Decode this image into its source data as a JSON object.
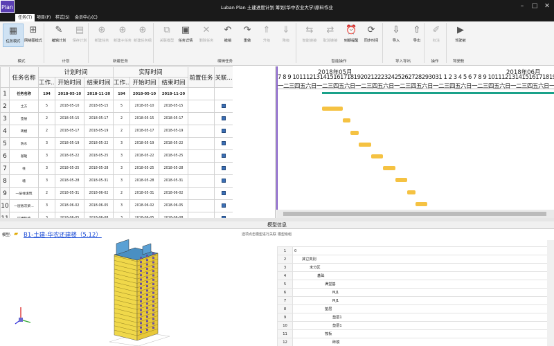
{
  "app": {
    "logo": "Plan",
    "title": "Luban Plan 土建进度计划 筹划(华中农业大学)原料作业"
  },
  "menu": [
    "任务(T)",
    "项目(P)",
    "样式(S)",
    "会员中心(C)"
  ],
  "ribbon": {
    "buttons": [
      {
        "label": "任务模式",
        "icon": "task-mode-icon",
        "glyph": "▦"
      },
      {
        "label": "网络图模式",
        "icon": "network-mode-icon",
        "glyph": "⊞"
      },
      {
        "label": "编辑计划",
        "icon": "edit-plan-icon",
        "glyph": "✎"
      },
      {
        "label": "保存计划",
        "icon": "save-plan-icon",
        "glyph": "▤"
      },
      {
        "label": "新建任务",
        "icon": "new-task-icon",
        "glyph": "⊕"
      },
      {
        "label": "新建子任务",
        "icon": "new-subtask-icon",
        "glyph": "⊕"
      },
      {
        "label": "新建任务组",
        "icon": "new-task-group-icon",
        "glyph": "⊕"
      },
      {
        "label": "关联模型",
        "icon": "link-model-icon",
        "glyph": "⧉"
      },
      {
        "label": "任务详情",
        "icon": "task-detail-icon",
        "glyph": "▣"
      },
      {
        "label": "删除任务",
        "icon": "delete-task-icon",
        "glyph": "✕"
      },
      {
        "label": "撤销",
        "icon": "undo-icon",
        "glyph": "↶"
      },
      {
        "label": "重做",
        "icon": "redo-icon",
        "glyph": "↷"
      },
      {
        "label": "升级",
        "icon": "upgrade-icon",
        "glyph": "⇑"
      },
      {
        "label": "降级",
        "icon": "downgrade-icon",
        "glyph": "⇓"
      },
      {
        "label": "智能链接",
        "icon": "smart-link-icon",
        "glyph": "⇆"
      },
      {
        "label": "取消链接",
        "icon": "unlink-icon",
        "glyph": "⇄"
      },
      {
        "label": "到期提醒",
        "icon": "due-reminder-icon",
        "glyph": "⏰"
      },
      {
        "label": "同步时间",
        "icon": "sync-time-icon",
        "glyph": "⟳"
      },
      {
        "label": "导入",
        "icon": "import-icon",
        "glyph": "⇩"
      },
      {
        "label": "导出",
        "icon": "export-icon",
        "glyph": "⇧"
      },
      {
        "label": "标注",
        "icon": "annotate-icon",
        "glyph": "✐"
      },
      {
        "label": "驾驶舱",
        "icon": "cockpit-icon",
        "glyph": "▶"
      }
    ],
    "groups": [
      "模式",
      "计划",
      "新建任务",
      "编辑任务",
      "智能操作",
      "导入导出",
      "操作",
      "驾驶舱"
    ]
  },
  "table": {
    "header": {
      "name": "任务名称",
      "plan": "计划时间",
      "actual": "实际时间",
      "work": "工作...",
      "start": "开始时间",
      "end": "结束时间",
      "pred": "前置任务",
      "rel": "关联..."
    },
    "rows": [
      {
        "n": "1",
        "name": "任务名称",
        "pw": "194",
        "ps": "2018-05-10",
        "pe": "2018-11-20",
        "aw": "194",
        "as": "2018-05-10",
        "ae": "2018-11-20"
      },
      {
        "n": "2",
        "name": "土方",
        "pw": "5",
        "ps": "2018-05-10",
        "pe": "2018-05-15",
        "aw": "5",
        "as": "2018-05-10",
        "ae": "2018-05-15"
      },
      {
        "n": "3",
        "name": "垫层",
        "pw": "2",
        "ps": "2018-05-15",
        "pe": "2018-05-17",
        "aw": "2",
        "as": "2018-05-15",
        "ae": "2018-05-17"
      },
      {
        "n": "4",
        "name": "砖模",
        "pw": "2",
        "ps": "2018-05-17",
        "pe": "2018-05-19",
        "aw": "2",
        "as": "2018-05-17",
        "ae": "2018-05-19"
      },
      {
        "n": "5",
        "name": "防水",
        "pw": "3",
        "ps": "2018-05-19",
        "pe": "2018-05-22",
        "aw": "3",
        "as": "2018-05-19",
        "ae": "2018-05-22"
      },
      {
        "n": "6",
        "name": "基础",
        "pw": "3",
        "ps": "2018-05-22",
        "pe": "2018-05-25",
        "aw": "3",
        "as": "2018-05-22",
        "ae": "2018-05-25"
      },
      {
        "n": "7",
        "name": "柱",
        "pw": "3",
        "ps": "2018-05-25",
        "pe": "2018-05-28",
        "aw": "3",
        "as": "2018-05-25",
        "ae": "2018-05-28"
      },
      {
        "n": "8",
        "name": "墙",
        "pw": "3",
        "ps": "2018-05-28",
        "pe": "2018-05-31",
        "aw": "3",
        "as": "2018-05-28",
        "ae": "2018-05-31"
      },
      {
        "n": "9",
        "name": "一层柱填筑",
        "pw": "2",
        "ps": "2018-05-31",
        "pe": "2018-06-02",
        "aw": "2",
        "as": "2018-05-31",
        "ae": "2018-06-02"
      },
      {
        "n": "10",
        "name": "一层板次梁...",
        "pw": "3",
        "ps": "2018-06-02",
        "pe": "2018-06-05",
        "aw": "3",
        "as": "2018-06-02",
        "ae": "2018-06-05"
      },
      {
        "n": "11",
        "name": "一层楼板填...",
        "pw": "3",
        "ps": "2018-06-05",
        "pe": "2018-06-08",
        "aw": "3",
        "as": "2018-06-05",
        "ae": "2018-06-08"
      },
      {
        "n": "12",
        "name": "二层柱填筑",
        "pw": "3",
        "ps": "2018-06-08",
        "pe": "2018-06-11",
        "aw": "3",
        "as": "2018-06-08",
        "ae": "2018-06-11"
      }
    ]
  },
  "gantt": {
    "month1": "2018年05月",
    "month2": "2018年06月",
    "days": "7 8 9 10111213141516171819202122232425262728293031 1 2 3 4 5 6 7 8 9 10111213141516171819202122",
    "weeks": "一二三四五六日一二三四五六日一二三四五六日一二三四五六日一二三四五六日一二三四五六日一二三四五六日一二三",
    "bars": [
      {
        "d0": 11,
        "d1": 16,
        "sum": true
      },
      {
        "d0": 11,
        "d1": 16
      },
      {
        "d0": 16,
        "d1": 18
      },
      {
        "d0": 18,
        "d1": 20
      },
      {
        "d0": 20,
        "d1": 23
      },
      {
        "d0": 23,
        "d1": 26
      },
      {
        "d0": 26,
        "d1": 29
      },
      {
        "d0": 29,
        "d1": 32
      },
      {
        "d0": 32,
        "d1": 34
      },
      {
        "d0": 34,
        "d1": 37
      },
      {
        "d0": 37,
        "d1": 40
      },
      {
        "d0": 40,
        "d1": 43
      }
    ]
  },
  "model": {
    "header": "模型信息",
    "label": "模型:",
    "link": "B1-土建-华农还建楼（5.12）",
    "hint": "选项点击模型进行关联",
    "tree_title": "模型级组",
    "tree": [
      {
        "n": "1",
        "t": "0",
        "lv": 0
      },
      {
        "n": "2",
        "t": "其它类别",
        "lv": 1
      },
      {
        "n": "3",
        "t": "未分区",
        "lv": 2
      },
      {
        "n": "4",
        "t": "基础",
        "lv": 3
      },
      {
        "n": "5",
        "t": "满堂基",
        "lv": 4
      },
      {
        "n": "6",
        "t": "MJ1",
        "lv": 5
      },
      {
        "n": "7",
        "t": "MJ1",
        "lv": 5
      },
      {
        "n": "8",
        "t": "垫层",
        "lv": 4
      },
      {
        "n": "9",
        "t": "垫层1",
        "lv": 5
      },
      {
        "n": "10",
        "t": "垫层1",
        "lv": 5
      },
      {
        "n": "11",
        "t": "筏板",
        "lv": 4
      },
      {
        "n": "12",
        "t": "砖模",
        "lv": 5
      }
    ]
  }
}
